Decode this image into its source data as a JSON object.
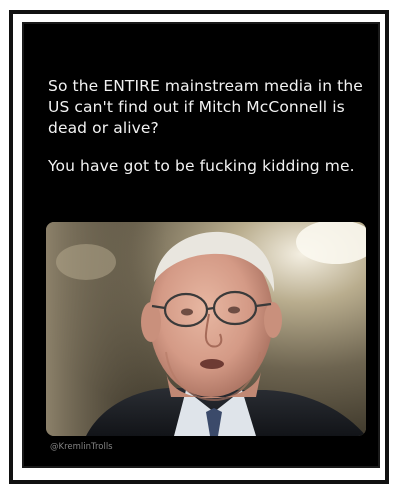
{
  "post": {
    "paragraphs": [
      "So the ENTIRE mainstream media in the US can't find out if Mitch McConnell is dead or alive?",
      "You have got to be fucking kidding me."
    ],
    "watermark": "@KremlinTrolls"
  },
  "colors": {
    "card_background": "#000000",
    "text": "#f2f2f2",
    "frame": "#111111",
    "watermark": "#9a9a9a"
  }
}
